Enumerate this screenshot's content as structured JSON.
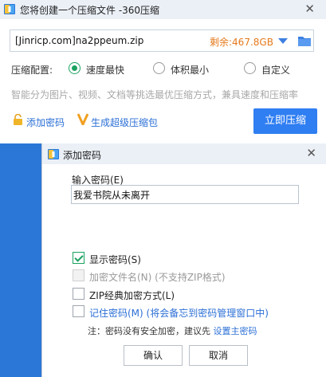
{
  "window": {
    "title": "您将创建一个压缩文件 -360压缩",
    "close_glyph": "✕"
  },
  "path_field": {
    "value": "[Jinricp.com]na2ppeum.zip",
    "free_space": "剩余:467.8GB"
  },
  "compress_config": {
    "label": "压缩配置:",
    "options": [
      {
        "label": "速度最快",
        "selected": true
      },
      {
        "label": "体积最小",
        "selected": false
      },
      {
        "label": "自定义",
        "selected": false
      }
    ],
    "hint": "智能分为图片、视频、文档等挑选最优压缩方式，兼具速度和压缩率"
  },
  "actions": {
    "add_password": "添加密码",
    "create_sfx": "生成超级压缩包",
    "compress_now": "立即压缩"
  },
  "dialog": {
    "title": "添加密码",
    "close_glyph": "✕",
    "password_label": "输入密码(E)",
    "password_value": "我爱书院从未离开",
    "options": {
      "show_password": {
        "label": "显示密码(S)",
        "checked": true,
        "enabled": true
      },
      "encrypt_filenames": {
        "label": "加密文件名(N) (不支持ZIP格式)",
        "checked": false,
        "enabled": false
      },
      "zip_classic": {
        "label": "ZIP经典加密方式(L)",
        "checked": false,
        "enabled": true
      },
      "remember_password": {
        "label": "记住密码(M) (将会备忘到密码管理窗口中)",
        "checked": false,
        "enabled": true
      }
    },
    "note_prefix": "注：密码没有安全加密，建议先 ",
    "note_link": "设置主密码",
    "ok_label": "确认",
    "cancel_label": "取消"
  },
  "colors": {
    "accent_blue": "#2f7ef2",
    "link_blue": "#2b6fd6",
    "free_space_orange": "#e5791c",
    "check_green": "#1aa260"
  },
  "icons": [
    "app-icon",
    "close-icon",
    "dropdown-arrow-icon",
    "folder-icon",
    "lock-icon",
    "v-icon",
    "check-icon"
  ]
}
